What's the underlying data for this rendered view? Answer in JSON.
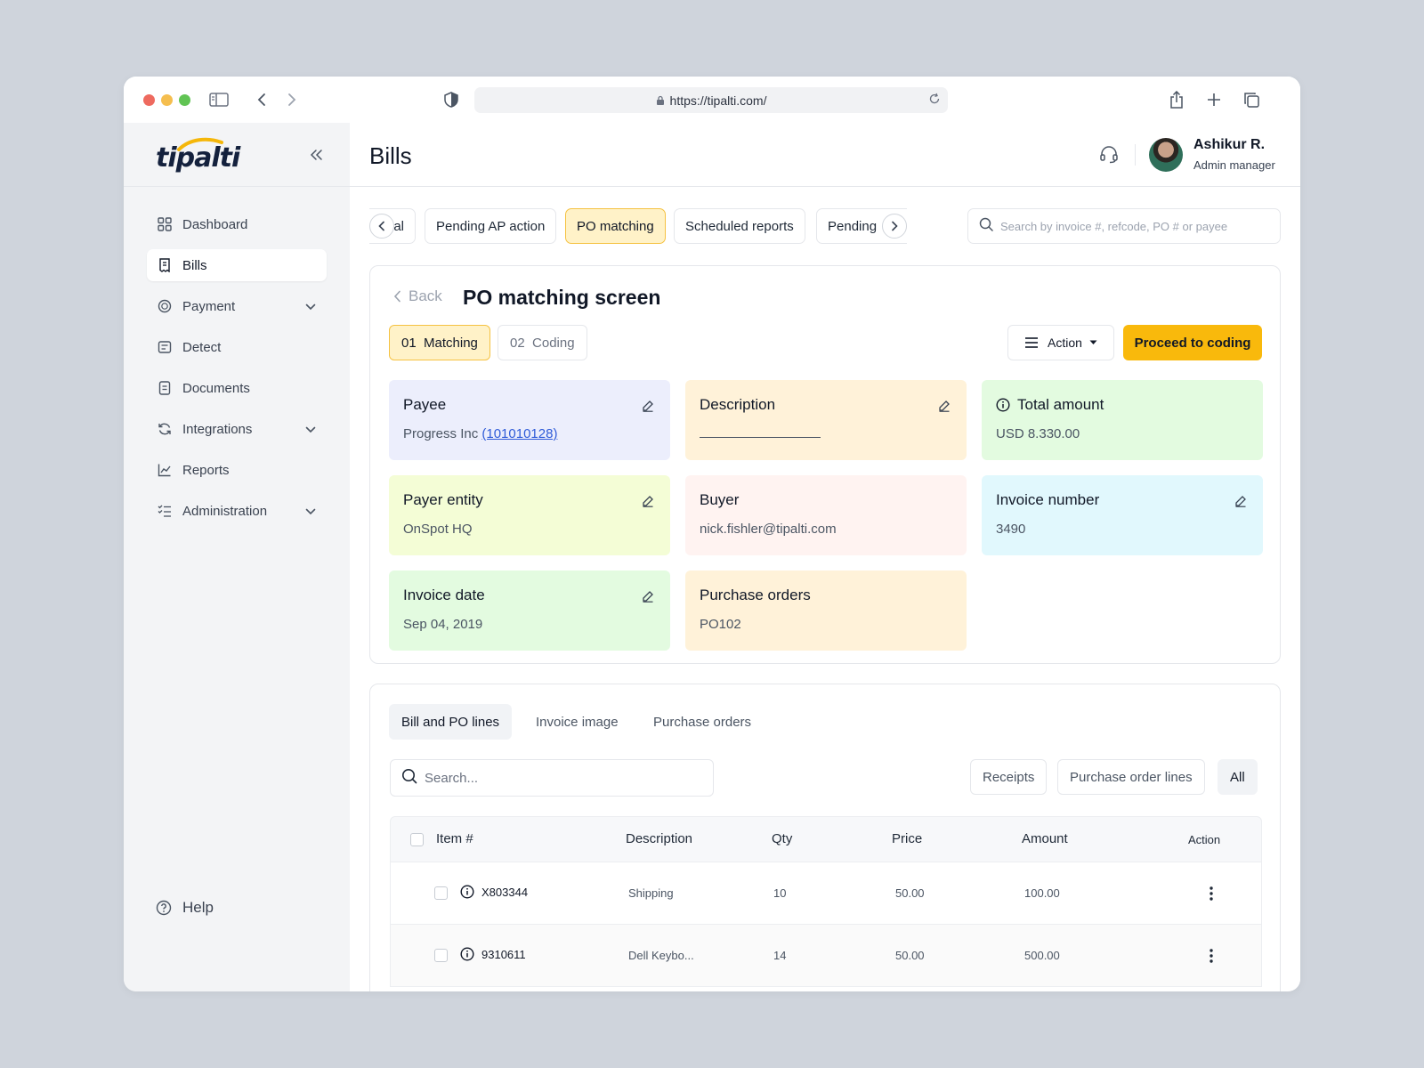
{
  "browser": {
    "url": "https://tipalti.com/"
  },
  "sidebar": {
    "logo": "tipalti",
    "items": [
      {
        "label": "Dashboard",
        "icon": "grid-icon",
        "active": false,
        "expandable": false
      },
      {
        "label": "Bills",
        "icon": "receipt-icon",
        "active": true,
        "expandable": false
      },
      {
        "label": "Payment",
        "icon": "coin-icon",
        "active": false,
        "expandable": true
      },
      {
        "label": "Detect",
        "icon": "scan-icon",
        "active": false,
        "expandable": false
      },
      {
        "label": "Documents",
        "icon": "document-icon",
        "active": false,
        "expandable": false
      },
      {
        "label": "Integrations",
        "icon": "sync-icon",
        "active": false,
        "expandable": true
      },
      {
        "label": "Reports",
        "icon": "chart-icon",
        "active": false,
        "expandable": false
      },
      {
        "label": "Administration",
        "icon": "checklist-icon",
        "active": false,
        "expandable": true
      }
    ],
    "help_label": "Help"
  },
  "header": {
    "title": "Bills",
    "user_name": "Ashikur R.",
    "user_role": "Admin manager"
  },
  "status_tabs": [
    {
      "label": "al",
      "active": false
    },
    {
      "label": "Pending AP action",
      "active": false
    },
    {
      "label": "PO matching",
      "active": true
    },
    {
      "label": "Scheduled reports",
      "active": false
    },
    {
      "label": "Pending",
      "active": false
    }
  ],
  "search": {
    "placeholder": "Search by invoice #, refcode, PO # or payee"
  },
  "po_screen": {
    "back_label": "Back",
    "title": "PO matching screen",
    "steps": [
      {
        "label": "01  Matching",
        "active": true
      },
      {
        "label": "02  Coding",
        "active": false
      }
    ],
    "action_label": "Action",
    "proceed_label": "Proceed to coding",
    "fields": {
      "payee": {
        "label": "Payee",
        "value": "Progress Inc",
        "link": "(101010128)",
        "color": "#eceefc"
      },
      "description": {
        "label": "Description",
        "value": "",
        "color": "#fff2d9"
      },
      "total_amount": {
        "label": "Total amount",
        "value": "USD 8.330.00",
        "color": "#e3fbe0"
      },
      "payer_entity": {
        "label": "Payer entity",
        "value": "OnSpot HQ",
        "color": "#f4fdd6"
      },
      "buyer": {
        "label": "Buyer",
        "value": "nick.fishler@tipalti.com",
        "color": "#fff3f1"
      },
      "invoice_number": {
        "label": "Invoice number",
        "value": "3490",
        "color": "#e1f8fd"
      },
      "invoice_date": {
        "label": "Invoice date",
        "value": "Sep 04, 2019",
        "color": "#e3fbe0"
      },
      "purchase_orders": {
        "label": "Purchase orders",
        "value": "PO102",
        "color": "#fff2d9"
      }
    }
  },
  "lines": {
    "tabs": [
      {
        "label": "Bill and PO lines",
        "active": true
      },
      {
        "label": "Invoice image",
        "active": false
      },
      {
        "label": "Purchase orders",
        "active": false
      }
    ],
    "search_placeholder": "Search...",
    "filters": [
      {
        "label": "Receipts",
        "active": false
      },
      {
        "label": "Purchase order lines",
        "active": false
      },
      {
        "label": "All",
        "active": true
      }
    ],
    "columns": {
      "item": "Item #",
      "description": "Description",
      "qty": "Qty",
      "price": "Price",
      "amount": "Amount",
      "action": "Action"
    },
    "rows": [
      {
        "item": "X803344",
        "description": "Shipping",
        "qty": "10",
        "price": "50.00",
        "amount": "100.00"
      },
      {
        "item": "9310611",
        "description": "Dell Keybo...",
        "qty": "14",
        "price": "50.00",
        "amount": "500.00"
      }
    ]
  }
}
